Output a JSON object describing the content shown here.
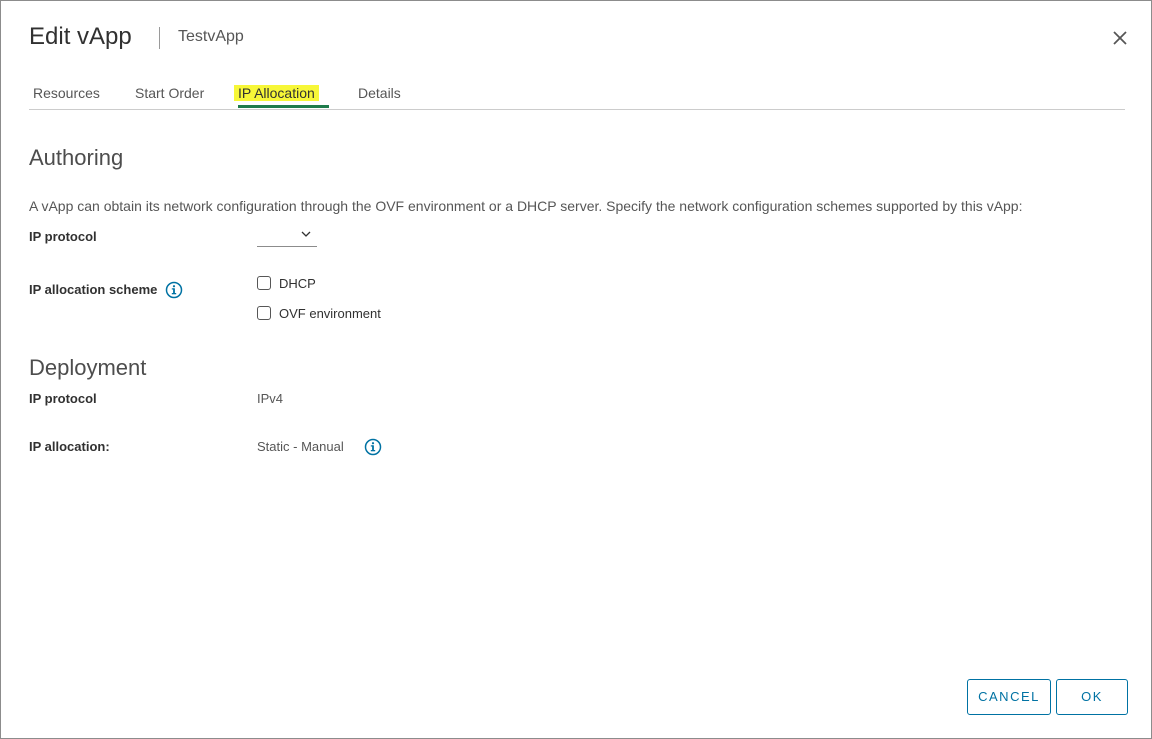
{
  "header": {
    "title": "Edit vApp",
    "subtitle": "TestvApp"
  },
  "tabs": [
    {
      "label": "Resources",
      "active": false
    },
    {
      "label": "Start Order",
      "active": false
    },
    {
      "label": "IP Allocation",
      "active": true
    },
    {
      "label": "Details",
      "active": false
    }
  ],
  "authoring": {
    "title": "Authoring",
    "description": "A vApp can obtain its network configuration through the OVF environment or a DHCP server. Specify the network configuration schemes supported by this vApp:",
    "ip_protocol_label": "IP protocol",
    "ip_protocol_value": "",
    "scheme_label": "IP allocation scheme",
    "options": [
      {
        "label": "DHCP",
        "checked": false
      },
      {
        "label": "OVF environment",
        "checked": false
      }
    ]
  },
  "deployment": {
    "title": "Deployment",
    "ip_protocol_label": "IP protocol",
    "ip_protocol_value": "IPv4",
    "ip_allocation_label": "IP allocation:",
    "ip_allocation_value": "Static - Manual"
  },
  "footer": {
    "cancel_label": "CANCEL",
    "ok_label": "OK"
  },
  "colors": {
    "accent": "#0072a3",
    "tab_underline": "#1e7b4b",
    "tab_highlight": "#f7f738"
  }
}
